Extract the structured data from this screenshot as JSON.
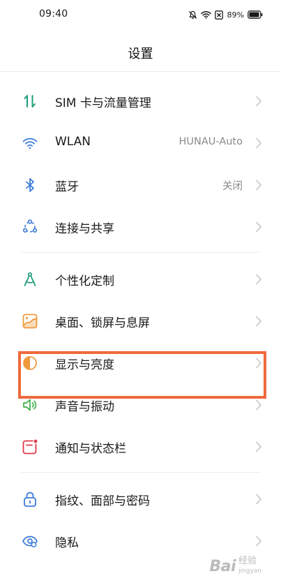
{
  "status_bar": {
    "time": "09:40",
    "battery": "89%",
    "icons": [
      "mute-bell-icon",
      "wifi-icon",
      "sim-off-icon",
      "battery-icon"
    ]
  },
  "header": {
    "title": "设置"
  },
  "rows": [
    {
      "label": "SIM 卡与流量管理",
      "value": "",
      "icon": "sim-data-icon",
      "icon_color": "#1f9e7a"
    },
    {
      "label": "WLAN",
      "value": "HUNAU-Auto",
      "icon": "wifi-icon",
      "icon_color": "#3c7bd9"
    },
    {
      "label": "蓝牙",
      "value": "关闭",
      "icon": "bluetooth-icon",
      "icon_color": "#3c7bd9"
    },
    {
      "label": "连接与共享",
      "value": "",
      "icon": "share-connections-icon",
      "icon_color": "#3c7bd9"
    },
    {
      "label": "个性化定制",
      "value": "",
      "icon": "compass-icon",
      "icon_color": "#1f9e7a"
    },
    {
      "label": "桌面、锁屏与息屏",
      "value": "",
      "icon": "wallpaper-icon",
      "icon_color": "#f09a3c"
    },
    {
      "label": "显示与亮度",
      "value": "",
      "icon": "brightness-icon",
      "icon_color": "#f09a3c"
    },
    {
      "label": "声音与振动",
      "value": "",
      "icon": "speaker-icon",
      "icon_color": "#3fae49"
    },
    {
      "label": "通知与状态栏",
      "value": "",
      "icon": "notification-icon",
      "icon_color": "#e0394a"
    },
    {
      "label": "指纹、面部与密码",
      "value": "",
      "icon": "lock-icon",
      "icon_color": "#3c7bd9"
    },
    {
      "label": "隐私",
      "value": "",
      "icon": "privacy-eye-icon",
      "icon_color": "#3c7bd9"
    }
  ],
  "highlight": {
    "target": "显示与亮度",
    "color": "#f06a3c"
  },
  "watermark": {
    "main": "Bai",
    "sub_top": "经验",
    "sub_bottom": "jingyan"
  }
}
